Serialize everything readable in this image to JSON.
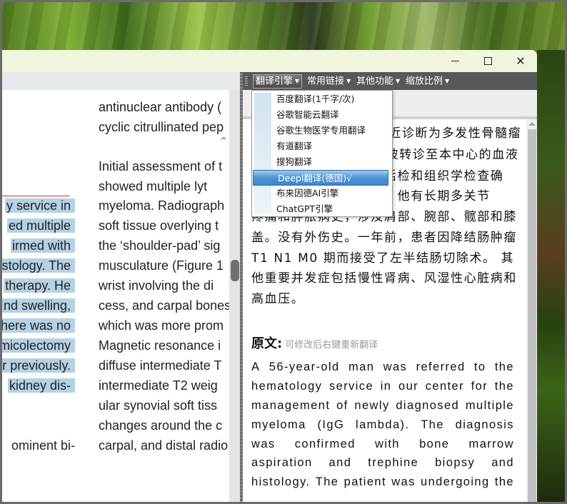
{
  "window": {
    "controls": {
      "minimize": "minimize",
      "maximize": "maximize",
      "close": "close"
    }
  },
  "left_pane": {
    "scroll_up_glyph": "^",
    "left_column_lines": [
      {
        "text": "y service in",
        "selected": true
      },
      {
        "text": "ed multiple",
        "selected": true
      },
      {
        "text": "irmed with",
        "selected": true
      },
      {
        "text": "stology. The",
        "selected": true
      },
      {
        "text": "therapy. He",
        "selected": true
      },
      {
        "text": "nd swelling,",
        "selected": true
      },
      {
        "text": "here was no",
        "selected": true
      },
      {
        "text": "micolectomy",
        "selected": true
      },
      {
        "text": "r previously.",
        "selected": true
      },
      {
        "text": "kidney dis-",
        "selected": true
      },
      {
        "text": "ominent bi-",
        "selected": false
      }
    ],
    "right_column_lines": [
      "antinuclear antibody (",
      "cyclic citrullinated pep",
      "",
      "Initial assessment of t",
      "showed multiple lyt",
      "myeloma. Radiograph",
      "soft tissue overlying t",
      "the ‘shoulder-pad’ sig",
      "musculature (Figure 1",
      "wrist involving the di",
      "cess, and carpal bones",
      "which was more prom",
      "Magnetic resonance i",
      "diffuse intermediate T",
      "intermediate T2 weig",
      "ular synovial soft tiss",
      "changes around the c",
      "carpal, and distal radio"
    ]
  },
  "translator": {
    "menu": [
      {
        "label": "翻译引擎",
        "active": true
      },
      {
        "label": "常用链接",
        "active": false
      },
      {
        "label": "其他功能",
        "active": false
      },
      {
        "label": "缩放比例",
        "active": false
      }
    ],
    "dropdown_items": [
      {
        "label": "百度翻译(1千字/次)",
        "selected": false
      },
      {
        "label": "谷歌智能云翻译",
        "selected": false
      },
      {
        "label": "谷歌生物医学专用翻译",
        "selected": false
      },
      {
        "label": "有道翻译",
        "selected": false
      },
      {
        "label": "搜狗翻译",
        "selected": false
      },
      {
        "label": "Deepl翻译(德国)√",
        "selected": true
      },
      {
        "label": "布来因德AI引擎",
        "selected": false
      },
      {
        "label": "ChatGPT引擎",
        "selected": false
      }
    ],
    "translation_lines": [
      "一名56岁男性患者因新近诊断为多发性骨髓瘤",
      "（IgG lambda型）而被转诊至本中心的血液",
      "科。诊断经骨髓穿刺、活检和组织学检查确",
      "诊。患者正在接受化疗。他有长期多关节",
      "疼痛和肿胀病史，涉及肩部、腕部、髋部和膝",
      "盖。没有外伤史。一年前，患者因降结肠肿瘤",
      "T1 N1 M0 期而接受了左半结肠切除术。 其",
      "他重要并发症包括慢性肾病、风湿性心脏病和",
      "高血压。"
    ],
    "original_label": "原文:",
    "original_hint": "可修改后右键重新翻译",
    "original_lines": [
      "A 56-year-old man was referred to the",
      "hematology service in our center for the",
      "management of newly diagnosed multiple",
      "myeloma (IgG lambda). The diagnosis",
      "was confirmed with bone marrow",
      "aspiration and trephine biopsy and",
      "histology. The patient was undergoing the"
    ]
  }
}
